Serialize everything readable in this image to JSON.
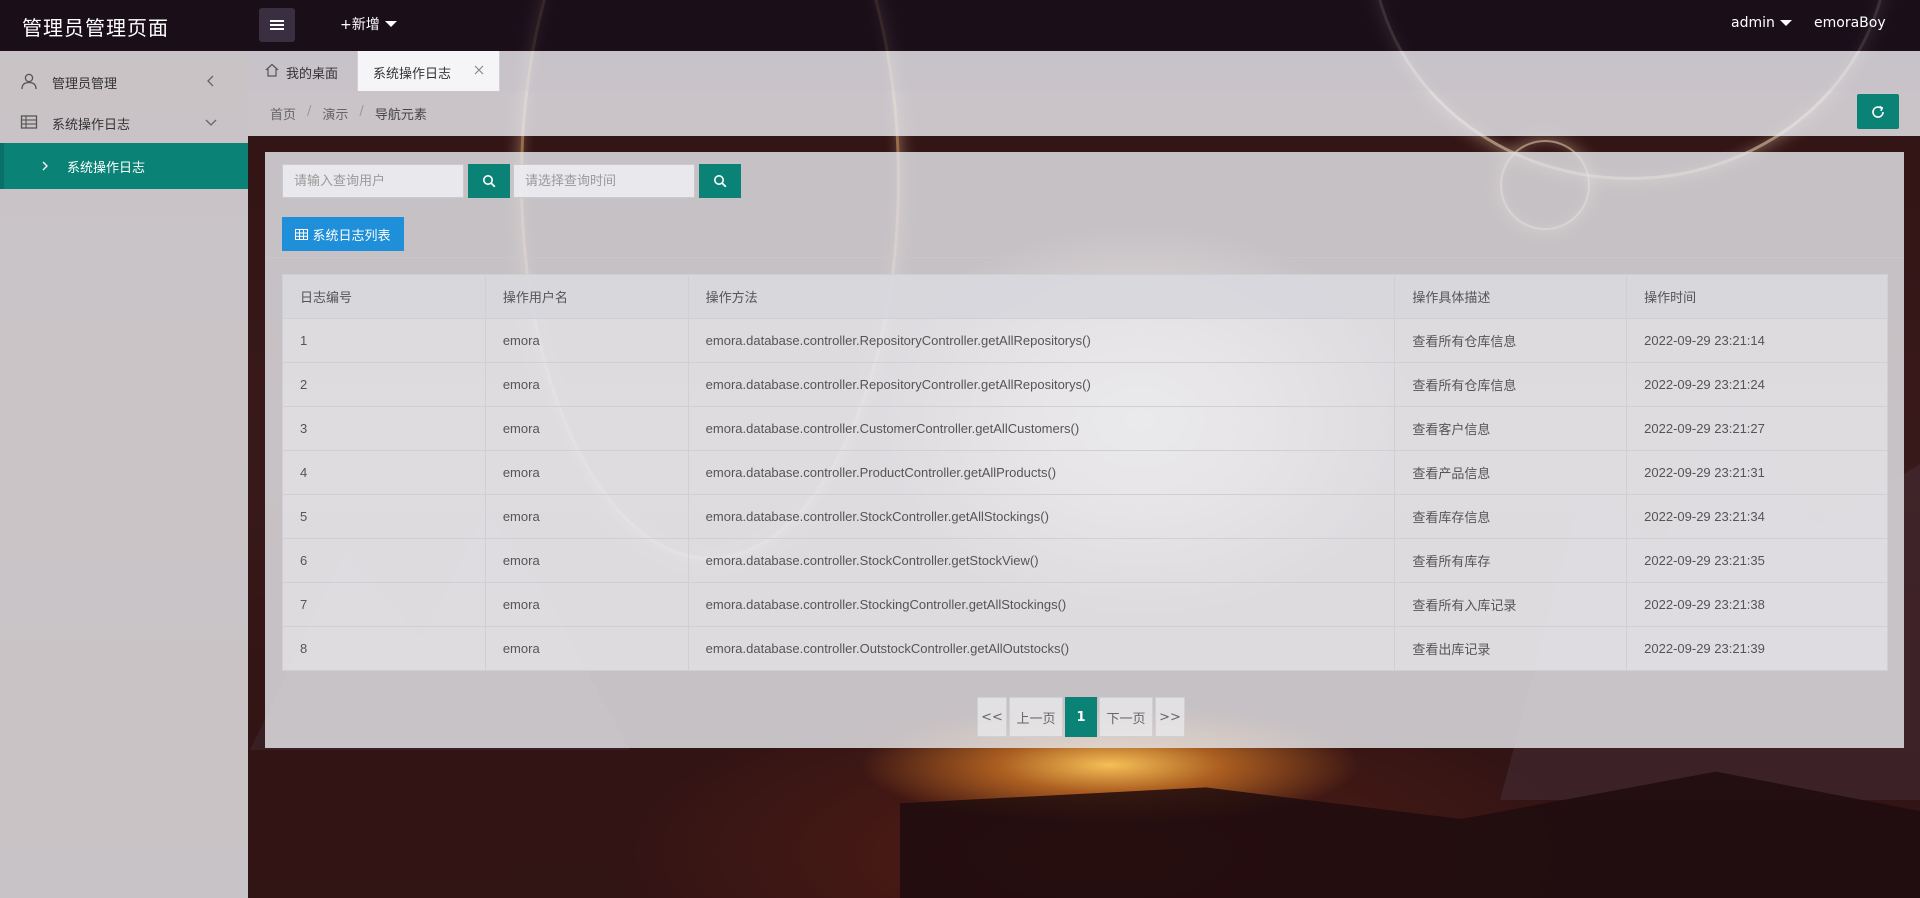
{
  "header": {
    "logo": "管理员管理页面",
    "add_new": "+新增",
    "admin": "admin",
    "user": "emoraBoy"
  },
  "sidebar": {
    "items": [
      {
        "label": "管理员管理",
        "icon": "user-icon"
      },
      {
        "label": "系统操作日志",
        "icon": "table-icon"
      }
    ],
    "sub_item": {
      "label": "系统操作日志"
    }
  },
  "tabs": [
    {
      "label": "我的桌面",
      "icon": "home-icon"
    },
    {
      "label": "系统操作日志",
      "active": true
    }
  ],
  "breadcrumb": [
    "首页",
    "演示",
    "导航元素"
  ],
  "search": {
    "user_placeholder": "请输入查询用户",
    "time_placeholder": "请选择查询时间"
  },
  "list_button": "系统日志列表",
  "table": {
    "columns": [
      "日志编号",
      "操作用户名",
      "操作方法",
      "操作具体描述",
      "操作时间"
    ],
    "rows": [
      [
        "1",
        "emora",
        "emora.database.controller.RepositoryController.getAllRepositorys()",
        "查看所有仓库信息",
        "2022-09-29 23:21:14"
      ],
      [
        "2",
        "emora",
        "emora.database.controller.RepositoryController.getAllRepositorys()",
        "查看所有仓库信息",
        "2022-09-29 23:21:24"
      ],
      [
        "3",
        "emora",
        "emora.database.controller.CustomerController.getAllCustomers()",
        "查看客户信息",
        "2022-09-29 23:21:27"
      ],
      [
        "4",
        "emora",
        "emora.database.controller.ProductController.getAllProducts()",
        "查看产品信息",
        "2022-09-29 23:21:31"
      ],
      [
        "5",
        "emora",
        "emora.database.controller.StockController.getAllStockings()",
        "查看库存信息",
        "2022-09-29 23:21:34"
      ],
      [
        "6",
        "emora",
        "emora.database.controller.StockController.getStockView()",
        "查看所有库存",
        "2022-09-29 23:21:35"
      ],
      [
        "7",
        "emora",
        "emora.database.controller.StockingController.getAllStockings()",
        "查看所有入库记录",
        "2022-09-29 23:21:38"
      ],
      [
        "8",
        "emora",
        "emora.database.controller.OutstockController.getAllOutstocks()",
        "查看出库记录",
        "2022-09-29 23:21:39"
      ]
    ]
  },
  "pager": {
    "first": "<<",
    "prev": "上一页",
    "current": "1",
    "next": "下一页",
    "last": ">>"
  },
  "colors": {
    "accent": "#0a8276",
    "button_blue": "#1e8fd8"
  }
}
